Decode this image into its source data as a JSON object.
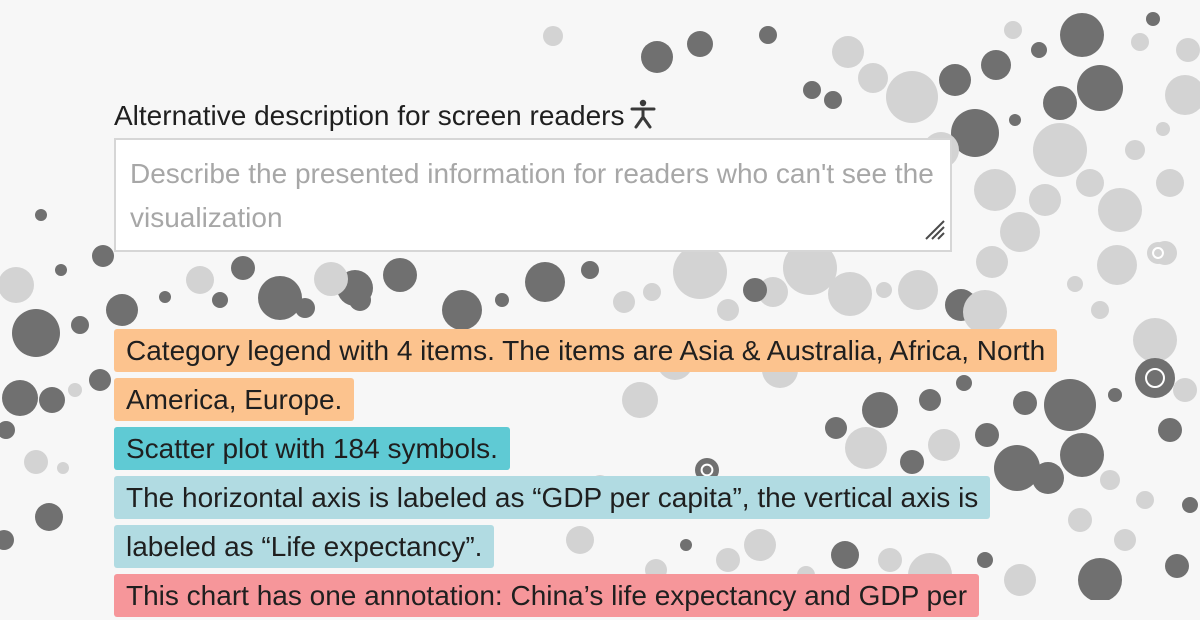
{
  "form": {
    "label": "Alternative description for screen readers",
    "label_icon": "accessibility-icon",
    "textarea_value": "",
    "textarea_placeholder": "Describe the presented information for readers who can't see the visualization"
  },
  "description_lines": {
    "legend": "Category legend with 4 items. The items are Asia & Australia, Africa, North America, Europe.",
    "scatter": "Scatter plot with 184 symbols.",
    "axis": "The horizontal axis is labeled as “GDP per capita”, the vertical axis is labeled as “Life expectancy”.",
    "annotation": "This chart has one annotation: China’s life expectancy and GDP per"
  },
  "colors": {
    "background": "#f7f7f7",
    "dot_dark": "#707070",
    "dot_light": "#d3d3d3",
    "legend_highlight": "#fcc38e",
    "scatter_highlight": "#5fcad4",
    "axis_highlight": "#b1dbe2",
    "annotation_highlight": "#f6969a"
  }
}
